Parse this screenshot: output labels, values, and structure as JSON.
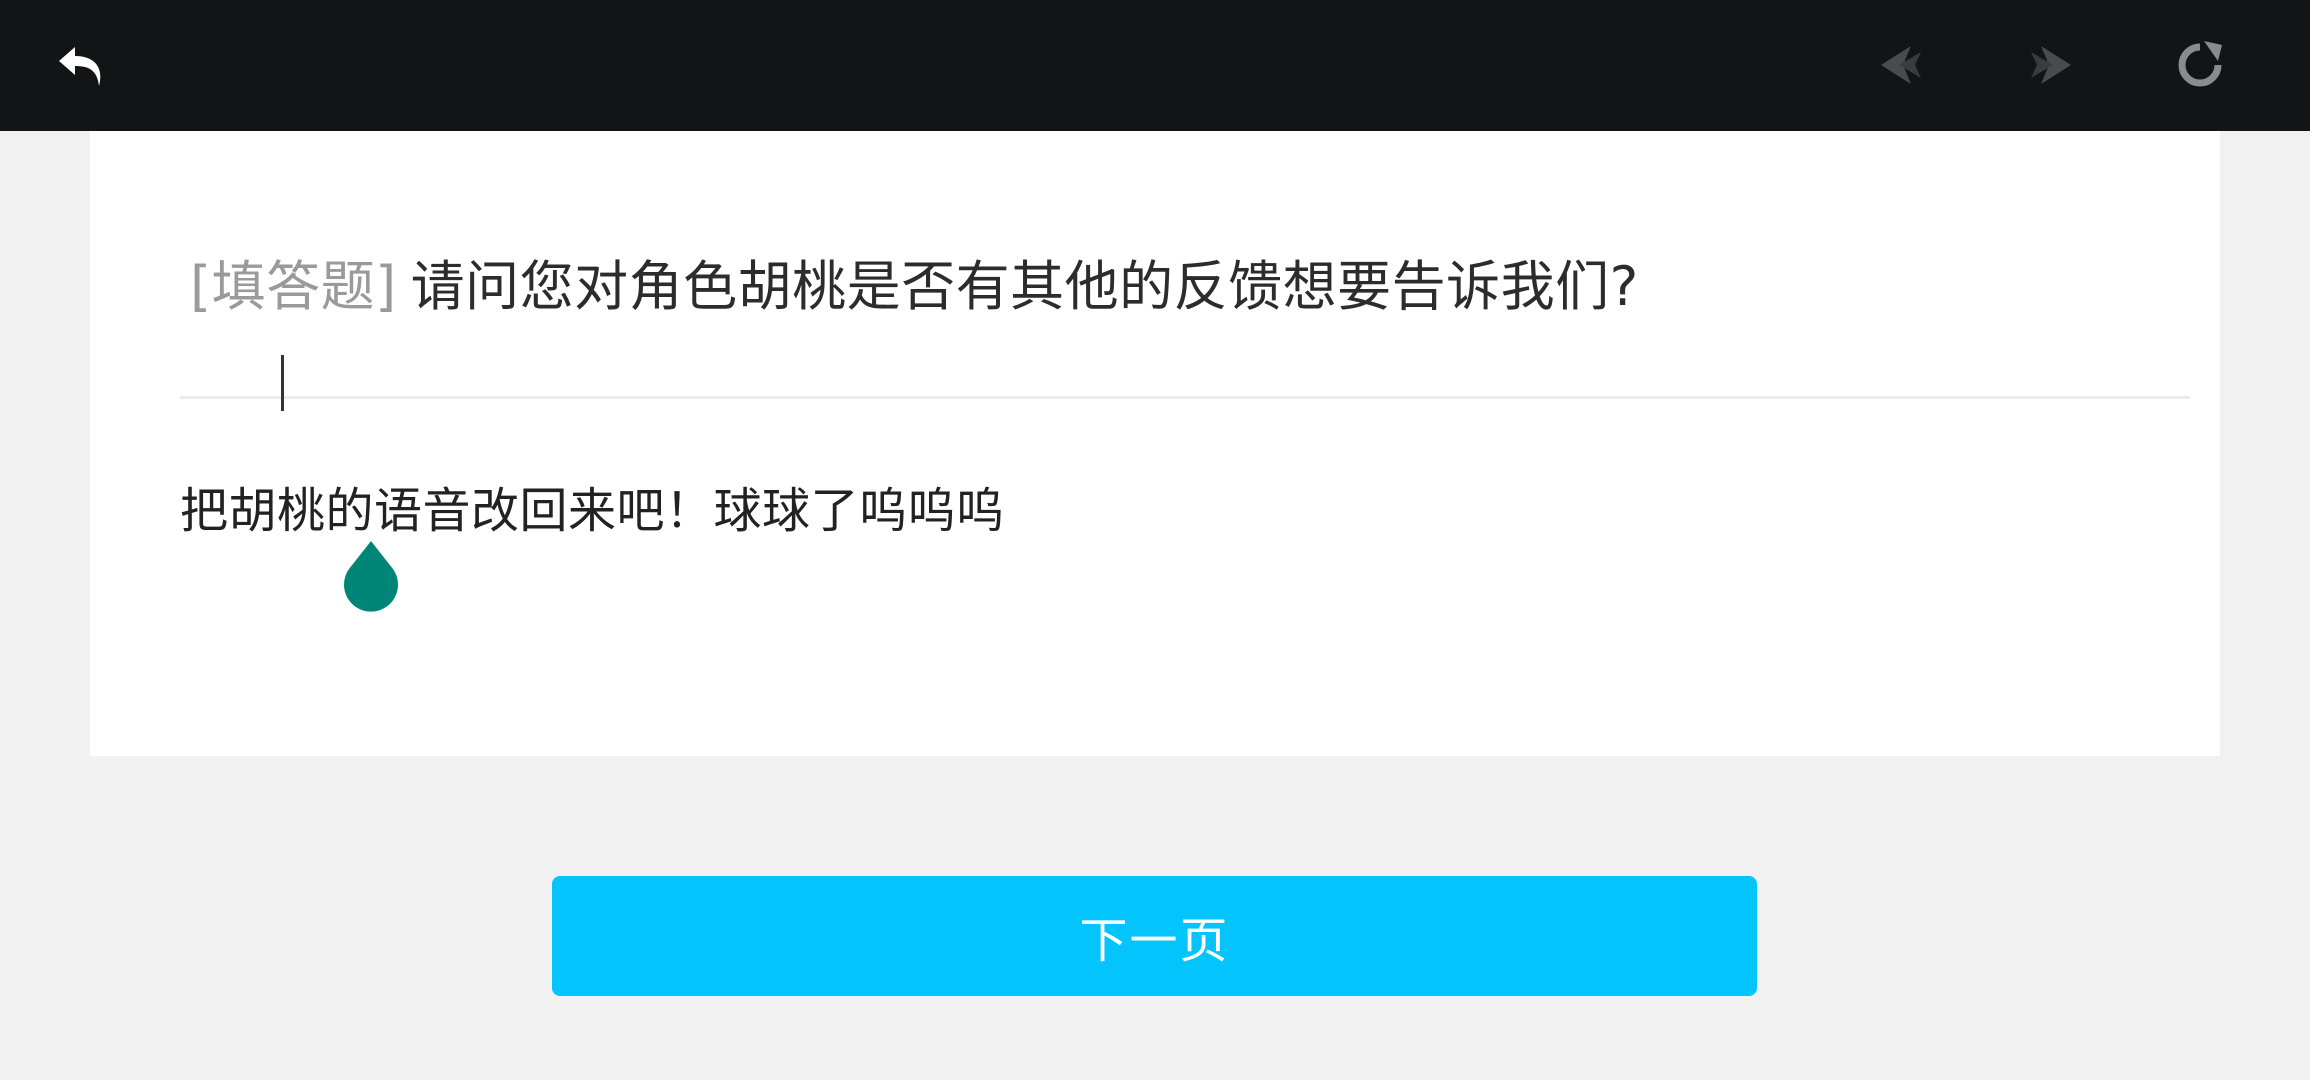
{
  "topbar": {
    "back_icon": "undo-arrow-icon",
    "prev_icon": "prev-page-icon",
    "next_icon": "next-page-icon",
    "refresh_icon": "refresh-icon",
    "colors": {
      "background": "#131416",
      "back_icon": "#ffffff",
      "disabled_icon": "#4a4b4e",
      "refresh_icon": "#8a8b8e"
    }
  },
  "question": {
    "type_label": "[填答题]",
    "text": "请问您对角色胡桃是否有其他的反馈想要告诉我们?"
  },
  "answer": {
    "value": "把胡桃的语音改回来吧！球球了呜呜呜",
    "cursor_handle_color": "#008577"
  },
  "footer": {
    "next_button_label": "下一页",
    "accent_color": "#03c4fc"
  }
}
